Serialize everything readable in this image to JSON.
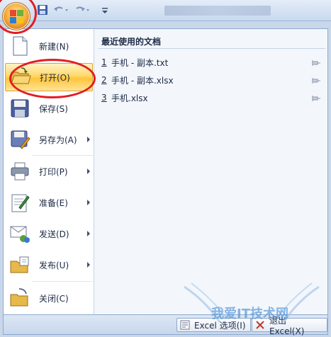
{
  "titlebar": {
    "quick_access": [
      "save-icon",
      "undo-icon",
      "redo-icon",
      "customize-icon"
    ]
  },
  "menu": {
    "items": [
      {
        "label": "新建(N)",
        "icon": "new-document-icon",
        "has_submenu": false
      },
      {
        "label": "打开(O)",
        "icon": "open-folder-icon",
        "has_submenu": false,
        "active": true
      },
      {
        "label": "保存(S)",
        "icon": "save-disk-icon",
        "has_submenu": false
      },
      {
        "label": "另存为(A)",
        "icon": "save-as-icon",
        "has_submenu": true
      },
      {
        "label": "打印(P)",
        "icon": "printer-icon",
        "has_submenu": true
      },
      {
        "label": "准备(E)",
        "icon": "prepare-icon",
        "has_submenu": true
      },
      {
        "label": "发送(D)",
        "icon": "send-icon",
        "has_submenu": true
      },
      {
        "label": "发布(U)",
        "icon": "publish-icon",
        "has_submenu": true
      },
      {
        "label": "关闭(C)",
        "icon": "close-folder-icon",
        "has_submenu": false
      }
    ]
  },
  "recent": {
    "title": "最近使用的文档",
    "documents": [
      {
        "num": "1",
        "name": " 手机 - 副本.txt"
      },
      {
        "num": "2",
        "name": " 手机 - 副本.xlsx"
      },
      {
        "num": "3",
        "name": " 手机.xlsx"
      }
    ]
  },
  "bottom": {
    "options_label": "Excel 选项(I)",
    "exit_label": "退出 Excel(X)"
  },
  "watermark": {
    "text": "我爱IT技术网"
  },
  "colors": {
    "accent_orange": "#ffc53a",
    "highlight_circle": "#e21d24",
    "panel_bg": "#f3f6fb"
  }
}
